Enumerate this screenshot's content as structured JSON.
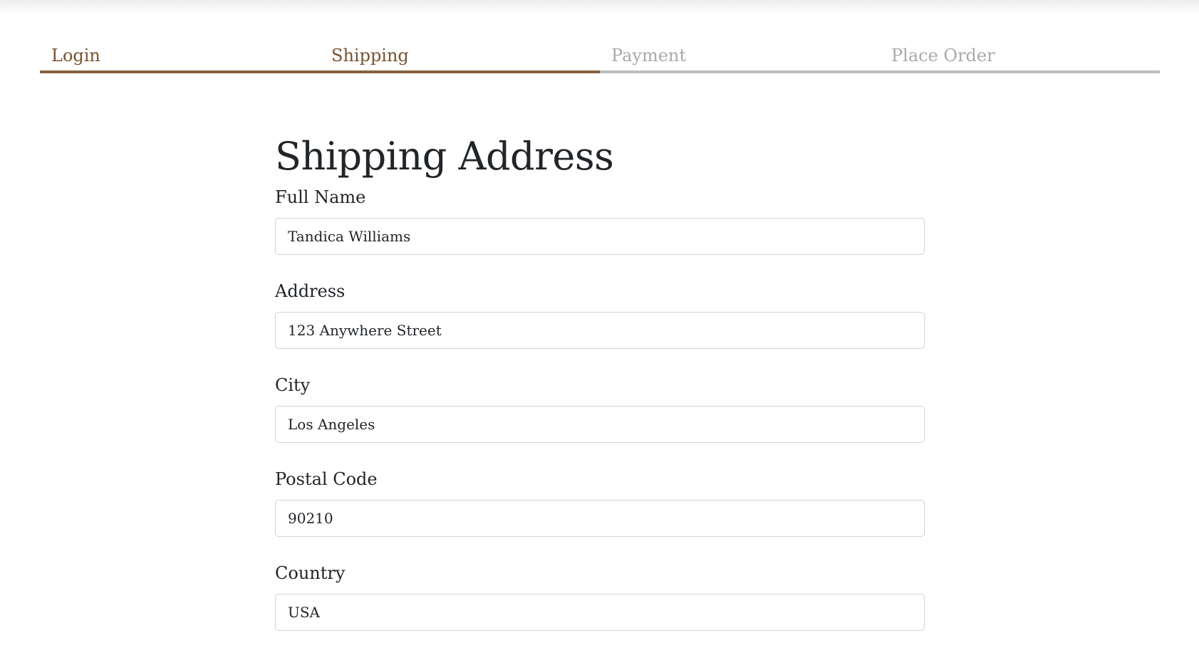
{
  "steps": [
    {
      "label": "Login",
      "state": "done"
    },
    {
      "label": "Shipping",
      "state": "done"
    },
    {
      "label": "Payment",
      "state": "pending"
    },
    {
      "label": "Place Order",
      "state": "pending"
    }
  ],
  "colors": {
    "active": "#85603f",
    "inactive": "#bdbdbd",
    "text": "#212529"
  },
  "page": {
    "title": "Shipping Address"
  },
  "form": {
    "full_name": {
      "label": "Full Name",
      "value": "Tandica Williams"
    },
    "address": {
      "label": "Address",
      "value": "123 Anywhere Street"
    },
    "city": {
      "label": "City",
      "value": "Los Angeles"
    },
    "postal_code": {
      "label": "Postal Code",
      "value": "90210"
    },
    "country": {
      "label": "Country",
      "value": "USA"
    }
  }
}
